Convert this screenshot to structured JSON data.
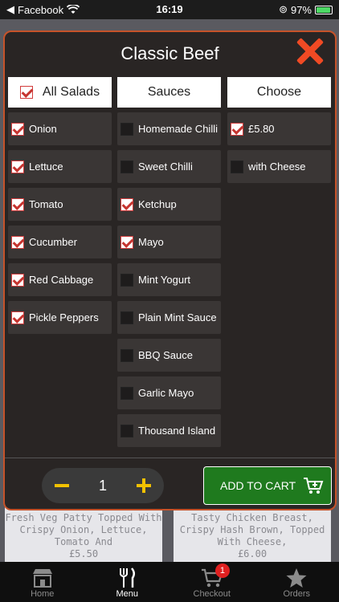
{
  "status": {
    "back_app": "Facebook",
    "time": "16:19",
    "battery": "97%",
    "battery_level": 0.97
  },
  "modal": {
    "title": "Classic Beef"
  },
  "columns": [
    {
      "header": "All Salads",
      "header_checked": true,
      "items": [
        {
          "label": "Onion",
          "checked": true
        },
        {
          "label": "Lettuce",
          "checked": true
        },
        {
          "label": "Tomato",
          "checked": true
        },
        {
          "label": "Cucumber",
          "checked": true
        },
        {
          "label": "Red Cabbage",
          "checked": true
        },
        {
          "label": "Pickle Peppers",
          "checked": true
        }
      ]
    },
    {
      "header": "Sauces",
      "header_checked": false,
      "items": [
        {
          "label": "Homemade Chilli",
          "checked": false
        },
        {
          "label": "Sweet Chilli",
          "checked": false
        },
        {
          "label": "Ketchup",
          "checked": true
        },
        {
          "label": "Mayo",
          "checked": true
        },
        {
          "label": "Mint Yogurt",
          "checked": false
        },
        {
          "label": "Plain Mint Sauce",
          "checked": false
        },
        {
          "label": "BBQ Sauce",
          "checked": false
        },
        {
          "label": "Garlic Mayo",
          "checked": false
        },
        {
          "label": "Thousand Island",
          "checked": false
        }
      ]
    },
    {
      "header": "Choose",
      "header_checked": false,
      "items": [
        {
          "label": "£5.80",
          "checked": true
        },
        {
          "label": "with Cheese",
          "checked": false
        }
      ]
    }
  ],
  "quantity": "1",
  "add_to_cart": "ADD TO CART",
  "background_cards": [
    {
      "text": "Fresh Veg Patty Topped With Crispy Onion, Lettuce, Tomato And",
      "price": "£5.50"
    },
    {
      "text": "Tasty Chicken Breast, Crispy Hash Brown, Topped With Cheese,",
      "price": "£6.00"
    }
  ],
  "tabs": [
    {
      "label": "Home",
      "icon": "store-icon"
    },
    {
      "label": "Menu",
      "icon": "fork-knife-icon",
      "active": true
    },
    {
      "label": "Checkout",
      "icon": "cart-icon",
      "badge": "1"
    },
    {
      "label": "Orders",
      "icon": "star-icon"
    }
  ],
  "colors": {
    "accent": "#f04a24",
    "modal_border": "#c6532a",
    "add_button": "#1f7a1e",
    "stepper_icons": "#f2c100",
    "check": "#c6342f"
  }
}
